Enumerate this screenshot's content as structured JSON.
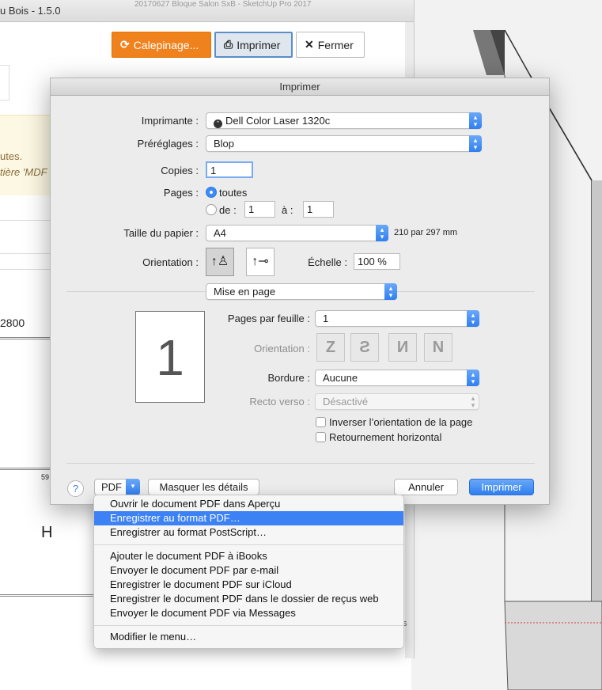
{
  "background": {
    "doc_title": "20170627 Bloque Salon SxB - SketchUp Pro 2017"
  },
  "plugin": {
    "title": "u Bois - 1.5.0",
    "buttons": {
      "calepinage": "Calepinage...",
      "imprimer": "Imprimer",
      "fermer": "Fermer"
    },
    "notice_line1": "utes.",
    "notice_line2": "tière 'MDF",
    "field_value": "2800",
    "ruler_label": "59",
    "letter": "H",
    "fragment": "s",
    "accent_color": "#f0821e"
  },
  "dialog": {
    "title": "Imprimer",
    "printer_label": "Imprimante :",
    "printer_value": "Dell Color Laser 1320c",
    "presets_label": "Préréglages :",
    "presets_value": "Blop",
    "copies_label": "Copies :",
    "copies_value": "1",
    "pages_label": "Pages :",
    "pages_all": "toutes",
    "pages_from": "de :",
    "pages_from_value": "1",
    "pages_to": "à :",
    "pages_to_value": "1",
    "paper_label": "Taille du papier :",
    "paper_value": "A4",
    "paper_dims": "210 par 297 mm",
    "orientation_label": "Orientation :",
    "scale_label": "Échelle :",
    "scale_value": "100 %",
    "section_value": "Mise en page",
    "preview_page": "1",
    "pages_per_sheet_label": "Pages par feuille :",
    "pages_per_sheet_value": "1",
    "layout_orientation_label": "Orientation :",
    "border_label": "Bordure :",
    "border_value": "Aucune",
    "duplex_label": "Recto verso :",
    "duplex_value": "Désactivé",
    "reverse_label": "Inverser l’orientation de la page",
    "flip_label": "Retournement horizontal",
    "help": "?",
    "pdf": "PDF",
    "hide_details": "Masquer les détails",
    "cancel": "Annuler",
    "print": "Imprimer",
    "primary_color": "#2f7ff0"
  },
  "pdf_menu": {
    "items": [
      "Ouvrir le document PDF dans Aperçu",
      "Enregistrer au format PDF…",
      "Enregistrer au format PostScript…",
      "Ajouter le document PDF à iBooks",
      "Envoyer le document PDF par e-mail",
      "Enregistrer le document PDF sur iCloud",
      "Enregistrer le document PDF dans le dossier de reçus web",
      "Envoyer le document PDF via Messages",
      "Modifier le menu…"
    ],
    "highlighted": "Enregistrer au format PDF…"
  }
}
